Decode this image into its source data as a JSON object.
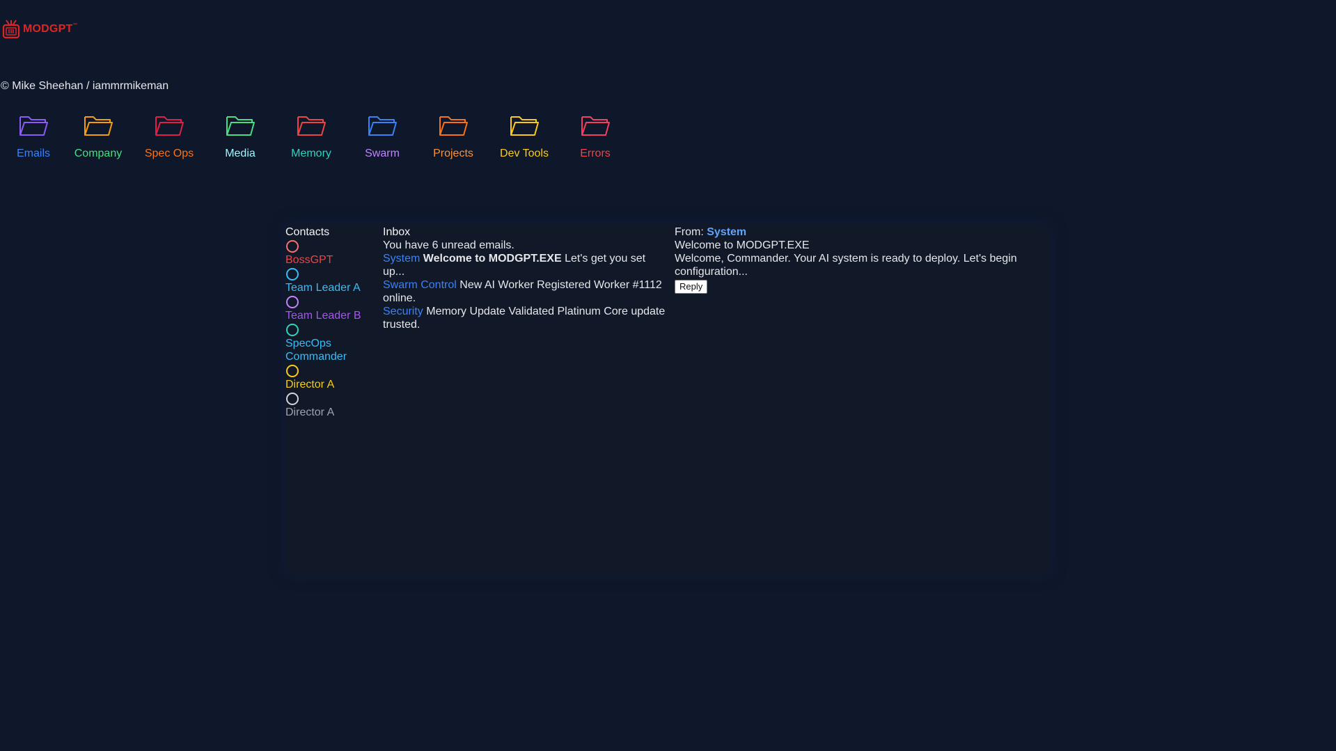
{
  "app": {
    "logo_text": "MODGPT",
    "logo_mark": "™",
    "copyright": "© Mike Sheehan / iammrmikeman"
  },
  "folders": [
    {
      "label": "Emails",
      "color": "#3b82f6",
      "icon_color": "#8b5cf6"
    },
    {
      "label": "Company",
      "color": "#4ade80",
      "icon_color": "#f59e0b"
    },
    {
      "label": "Spec Ops",
      "color": "#f97316",
      "icon_color": "#e11d48"
    },
    {
      "label": "Media",
      "color": "#a5f3fc",
      "icon_color": "#4ade80"
    },
    {
      "label": "Memory",
      "color": "#2dd4bf",
      "icon_color": "#ef4444"
    },
    {
      "label": "Swarm",
      "color": "#c084fc",
      "icon_color": "#3b82f6"
    },
    {
      "label": "Projects",
      "color": "#fb923c",
      "icon_color": "#f97316"
    },
    {
      "label": "Dev Tools",
      "color": "#facc15",
      "icon_color": "#facc15"
    },
    {
      "label": "Errors",
      "color": "#ef4444",
      "icon_color": "#f43f5e"
    }
  ],
  "contacts": {
    "title": "Contacts",
    "items": [
      {
        "name": "BossGPT",
        "color": "#ef4444",
        "ring": "#f87171"
      },
      {
        "name": "Team Leader A",
        "color": "#38bdf8",
        "ring": "#38bdf8"
      },
      {
        "name": "Team Leader B",
        "color": "#a855f7",
        "ring": "#c084fc"
      },
      {
        "name": "SpecOps Commander",
        "color": "#38bdf8",
        "ring": "#2dd4bf"
      },
      {
        "name": "Director A",
        "color": "#facc15",
        "ring": "#facc15"
      },
      {
        "name": "Director A",
        "color": "#9ca3af",
        "ring": "#d1d5db"
      }
    ]
  },
  "inbox": {
    "title": "Inbox",
    "summary": "You have 6 unread emails.",
    "emails": [
      {
        "from": "System",
        "subject": "Welcome to MODGPT.EXE",
        "preview": "Let's get you set up..."
      },
      {
        "from": "Swarm Control",
        "subject": "New AI Worker Registered",
        "preview": "Worker #1112 online."
      },
      {
        "from": "Security",
        "subject": "Memory Update Validated",
        "preview": "Platinum Core update trusted."
      }
    ]
  },
  "detail": {
    "from_label": "From:",
    "from_name": "System",
    "subject": "Welcome to MODGPT.EXE",
    "body": "Welcome, Commander. Your AI system is ready to deploy. Let's begin configuration...",
    "reply_label": "Reply"
  }
}
